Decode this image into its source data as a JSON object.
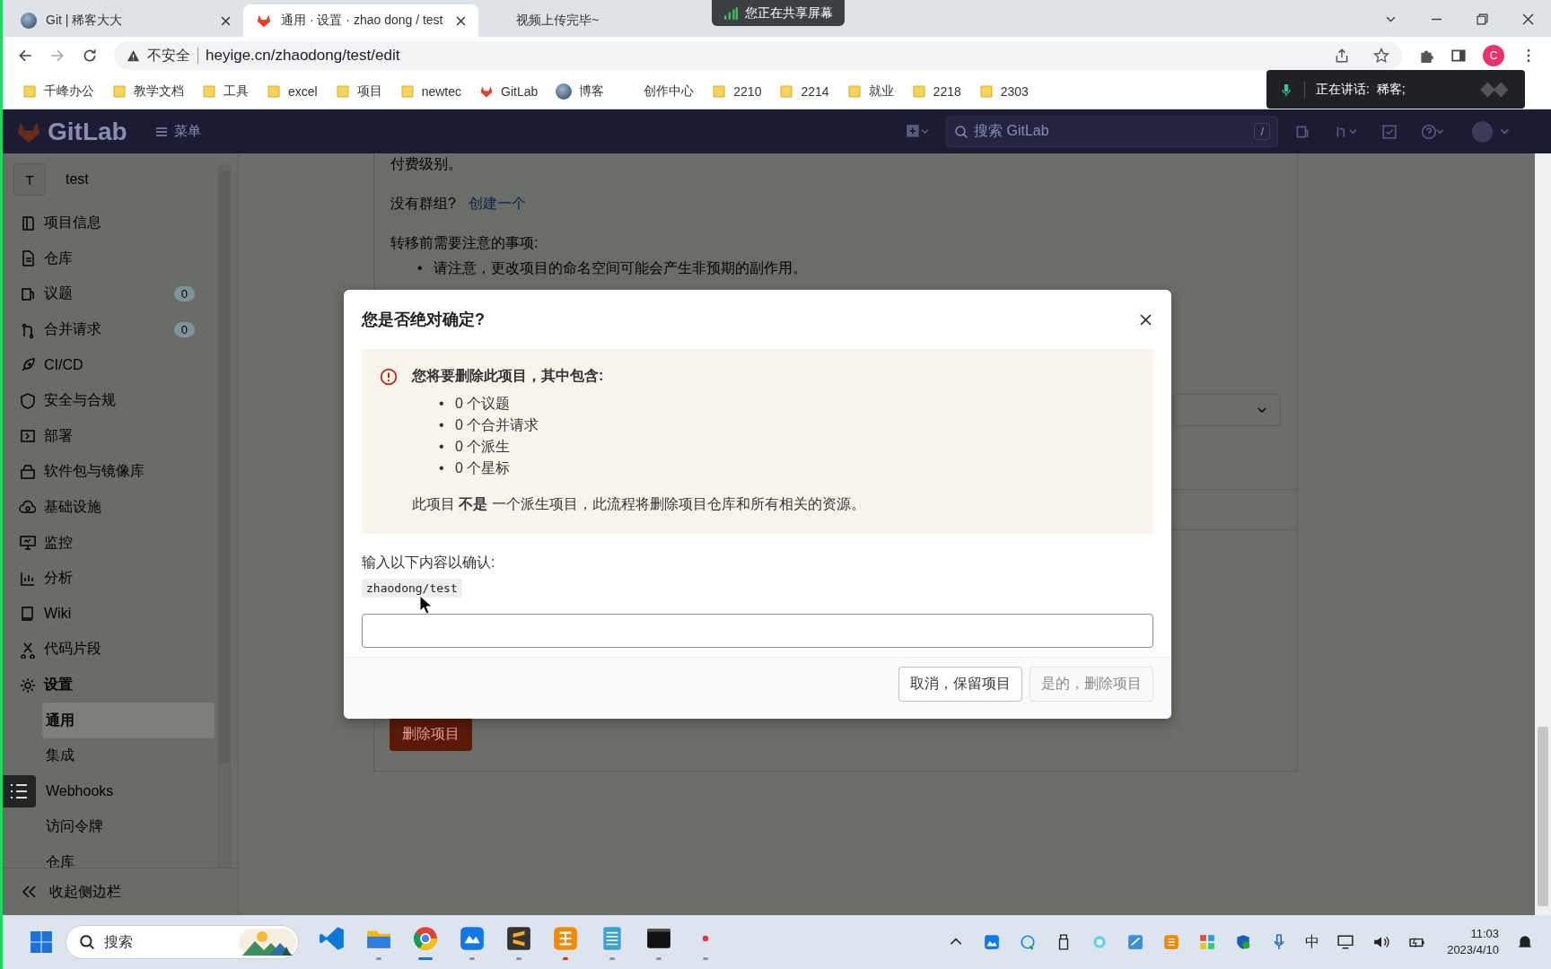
{
  "browser": {
    "tabs": [
      {
        "title": "Git | 稀客大大",
        "kind": "avatar",
        "selected": false
      },
      {
        "title": "通用 · 设置 · zhao dong / test",
        "kind": "gitlab",
        "selected": true
      },
      {
        "title": "视频上传完毕~",
        "kind": "plain",
        "selected": false
      }
    ],
    "address": {
      "security": "不安全",
      "url": "heyige.cn/zhaodong/test/edit"
    },
    "profile": "C",
    "bookmarks": [
      {
        "label": "千峰办公",
        "kind": "folder"
      },
      {
        "label": "教学文档",
        "kind": "folder"
      },
      {
        "label": "工具",
        "kind": "folder"
      },
      {
        "label": "excel",
        "kind": "folder"
      },
      {
        "label": "项目",
        "kind": "folder"
      },
      {
        "label": "newtec",
        "kind": "folder"
      },
      {
        "label": "GitLab",
        "kind": "gitlab"
      },
      {
        "label": "博客",
        "kind": "avatar"
      },
      {
        "label": "创作中心",
        "kind": "plain"
      },
      {
        "label": "2210",
        "kind": "folder"
      },
      {
        "label": "2214",
        "kind": "folder"
      },
      {
        "label": "就业",
        "kind": "folder"
      },
      {
        "label": "2218",
        "kind": "folder"
      },
      {
        "label": "2303",
        "kind": "folder"
      }
    ]
  },
  "share_banner": "您正在共享屏幕",
  "speaking_panel": "正在讲话:  稀客;",
  "gitlab": {
    "logo": "GitLab",
    "menu": "菜单",
    "search_placeholder": "搜索 GitLab",
    "shortcut": "/"
  },
  "sidebar": {
    "project": {
      "initial": "T",
      "name": "test"
    },
    "items": [
      {
        "label": "项目信息",
        "selected": false
      },
      {
        "label": "仓库",
        "selected": false
      },
      {
        "label": "议题",
        "count": "0",
        "selected": false
      },
      {
        "label": "合并请求",
        "count": "0",
        "selected": false
      },
      {
        "label": "CI/CD",
        "selected": false
      },
      {
        "label": "安全与合规",
        "selected": false
      },
      {
        "label": "部署",
        "selected": false
      },
      {
        "label": "软件包与镜像库",
        "selected": false
      },
      {
        "label": "基础设施",
        "selected": false
      },
      {
        "label": "监控",
        "selected": false
      },
      {
        "label": "分析",
        "selected": false
      },
      {
        "label": "Wiki",
        "selected": false
      },
      {
        "label": "代码片段",
        "selected": false
      },
      {
        "label": "设置",
        "selected": false,
        "expanded": true,
        "children": [
          {
            "label": "通用",
            "selected": true
          },
          {
            "label": "集成",
            "selected": false
          },
          {
            "label": "Webhooks",
            "selected": false
          },
          {
            "label": "访问令牌",
            "selected": false
          },
          {
            "label": "仓库",
            "selected": false
          }
        ]
      }
    ],
    "collapse": "收起侧边栏"
  },
  "page": {
    "paid_note": "付费级别。",
    "no_group": "没有群组?",
    "create_link": "创建一个",
    "notes_heading": "转移前需要注意的事项:",
    "bullet": "•",
    "notes": [
      "请注意，更改项目的命名空间可能会产生非预期的副作用。"
    ],
    "delete_button": "删除项目"
  },
  "dialog": {
    "title": "您是否绝对确定?",
    "alert_heading": "您将要删除此项目，其中包含:",
    "bullet": "•",
    "contents": [
      "0 个议题",
      "0 个合并请求",
      "0 个派生",
      "0 个星标"
    ],
    "note": "此项目 **不是** 一个派生项目，此流程将删除项目仓库和所有相关的资源。",
    "confirm_label": "输入以下内容以确认:",
    "confirm_code": "zhaodong/test",
    "buttons": [
      {
        "label": "取消，保留项目",
        "disabled": false
      },
      {
        "label": "是的，删除项目",
        "disabled": true
      }
    ]
  },
  "taskbar": {
    "search_placeholder": "搜索",
    "apps": [
      {
        "running": false,
        "selected": false,
        "alert": false
      },
      {
        "running": true,
        "selected": false,
        "alert": false
      },
      {
        "running": true,
        "selected": true,
        "alert": false
      },
      {
        "running": true,
        "selected": false,
        "alert": false
      },
      {
        "running": true,
        "selected": false,
        "alert": false
      },
      {
        "running": true,
        "selected": false,
        "alert": true
      },
      {
        "running": true,
        "selected": false,
        "alert": false
      },
      {
        "running": true,
        "selected": false,
        "alert": false
      },
      {
        "running": true,
        "selected": false,
        "alert": false
      }
    ],
    "ime": "中",
    "time": "11:03",
    "date": "2023/4/10"
  }
}
